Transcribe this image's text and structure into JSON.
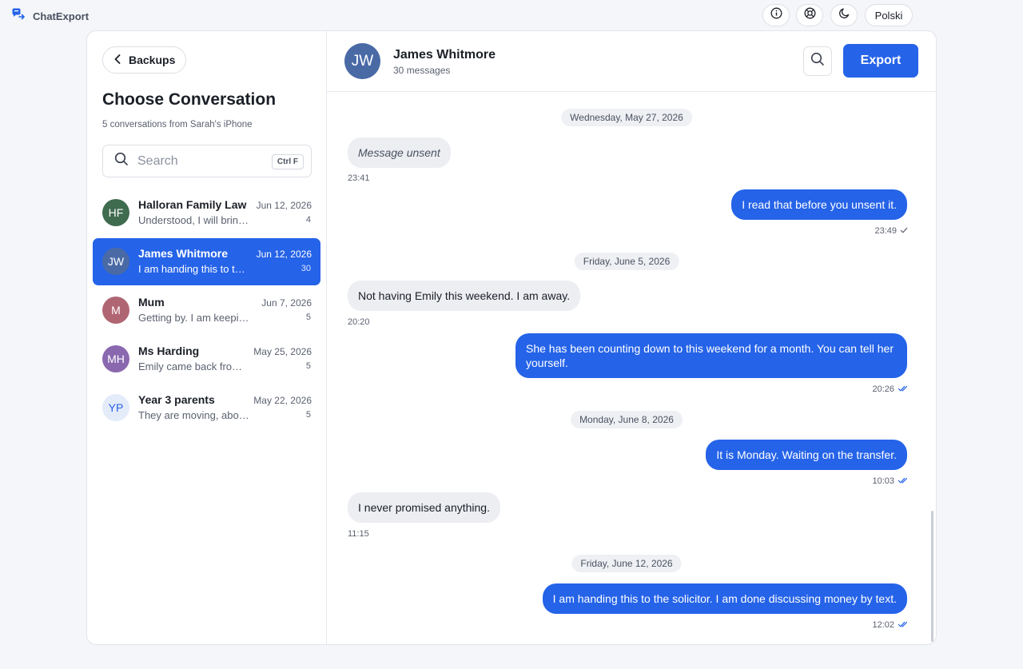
{
  "app": {
    "name": "ChatExport",
    "accent": "#2563e8"
  },
  "topbar": {
    "icons": [
      "info-icon",
      "lifebuoy-icon",
      "moon-icon"
    ],
    "language": "Polski"
  },
  "sidebar": {
    "back_label": "Backups",
    "title": "Choose Conversation",
    "subtitle": "5 conversations from Sarah's iPhone",
    "search": {
      "placeholder": "Search",
      "shortcut": "Ctrl F"
    },
    "conversations": [
      {
        "initials": "HF",
        "name": "Halloran Family Law",
        "preview": "Understood, I will bring the documents.",
        "date": "Jun 12, 2026",
        "count": "4",
        "color": "#3f6b4e",
        "active": false
      },
      {
        "initials": "JW",
        "name": "James Whitmore",
        "preview": "I am handing this to the solicitor.",
        "date": "Jun 12, 2026",
        "count": "30",
        "color": "#4a6aa6",
        "active": true
      },
      {
        "initials": "M",
        "name": "Mum",
        "preview": "Getting by. I am keeping busy.",
        "date": "Jun 7, 2026",
        "count": "5",
        "color": "#b06672",
        "active": false
      },
      {
        "initials": "MH",
        "name": "Ms Harding",
        "preview": "Emily came back from the trip.",
        "date": "May 25, 2026",
        "count": "5",
        "color": "#8a68b0",
        "active": false
      },
      {
        "initials": "YP",
        "name": "Year 3 parents",
        "preview": "They are moving, about the party.",
        "date": "May 22, 2026",
        "count": "5",
        "color": "#e4ebf9",
        "active": false
      }
    ]
  },
  "chat": {
    "initials": "JW",
    "name": "James Whitmore",
    "count_label": "30 messages",
    "export_label": "Export",
    "items": [
      {
        "type": "date",
        "text": "Wednesday, May 27, 2026"
      },
      {
        "type": "in",
        "text": "Message unsent",
        "unsent": true,
        "time": "23:41"
      },
      {
        "type": "out",
        "text": "I read that before you unsent it.",
        "time": "23:49",
        "status": "single-check"
      },
      {
        "type": "date",
        "text": "Friday, June 5, 2026"
      },
      {
        "type": "in",
        "text": "Not having Emily this weekend. I am away.",
        "time": "20:20"
      },
      {
        "type": "out",
        "text": "She has been counting down to this weekend for a month. You can tell her yourself.",
        "time": "20:26",
        "status": "double-check"
      },
      {
        "type": "date",
        "text": "Monday, June 8, 2026"
      },
      {
        "type": "out",
        "text": "It is Monday. Waiting on the transfer.",
        "time": "10:03",
        "status": "double-check"
      },
      {
        "type": "in",
        "text": "I never promised anything.",
        "time": "11:15"
      },
      {
        "type": "date",
        "text": "Friday, June 12, 2026"
      },
      {
        "type": "out",
        "text": "I am handing this to the solicitor. I am done discussing money by text.",
        "time": "12:02",
        "status": "double-check"
      }
    ]
  }
}
